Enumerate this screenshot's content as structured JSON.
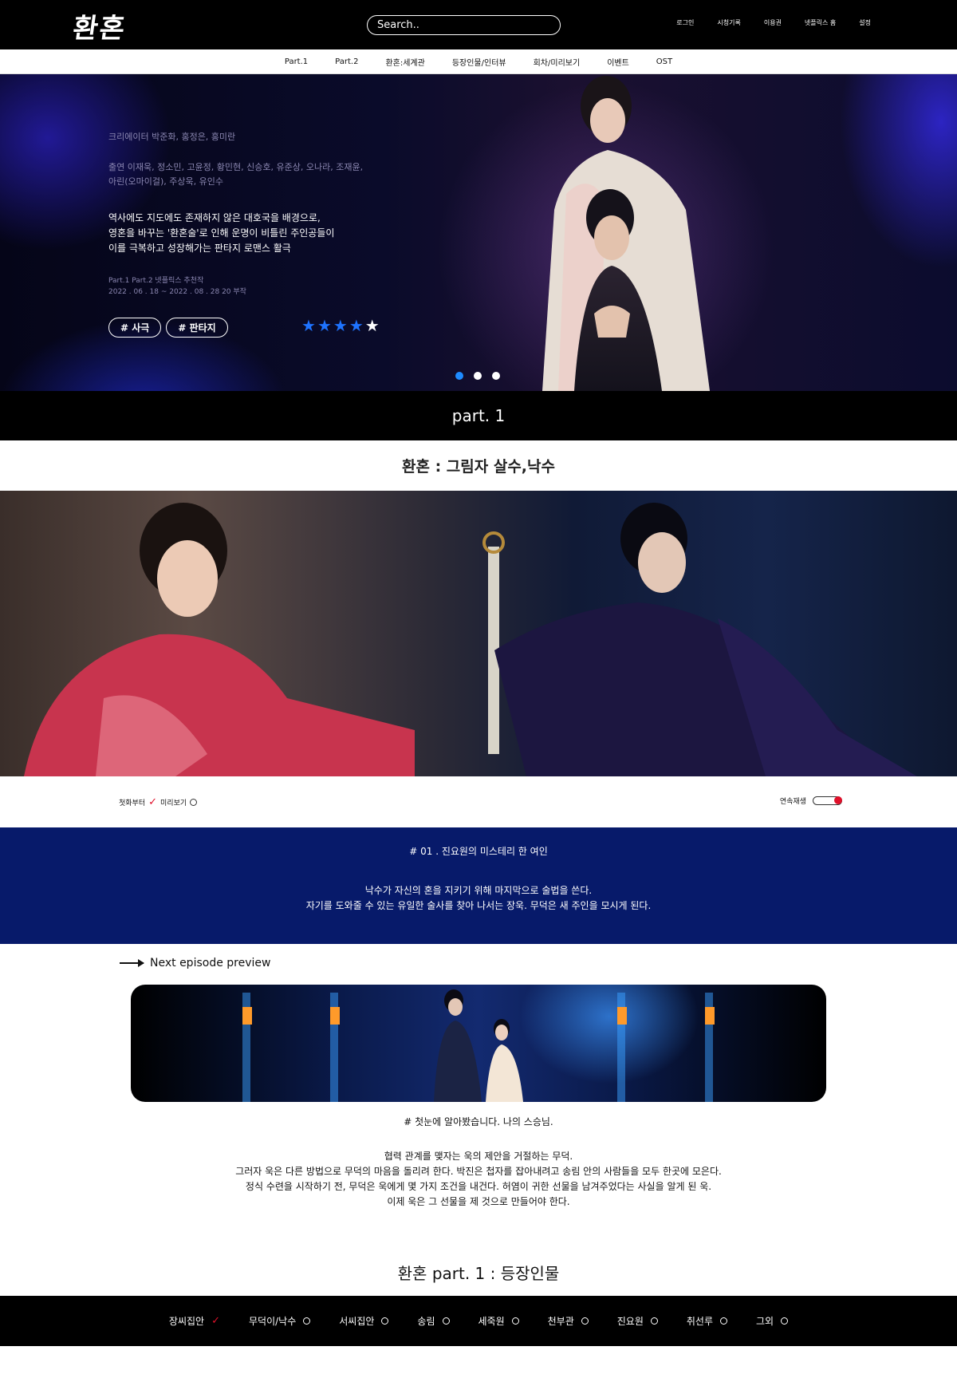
{
  "header": {
    "logo": "환혼",
    "search_placeholder": "Search..",
    "util_menu": [
      "로그인",
      "시청기록",
      "이용권",
      "넷플릭스 홈",
      "설정"
    ]
  },
  "nav": [
    "Part.1",
    "Part.2",
    "환혼:세계관",
    "등장인물/인터뷰",
    "회차/미리보기",
    "이벤트",
    "OST"
  ],
  "hero": {
    "creators": "크리에이터 박준화, 홍정은, 홍미란",
    "cast_line1": "출연 이재욱, 정소민, 고윤정, 황민현, 신승호, 유준상, 오나라, 조재윤,",
    "cast_line2": "아린(오마이걸), 주상욱, 유인수",
    "synopsis_line1": "역사에도 지도에도 존재하지 않은 대호국을 배경으로,",
    "synopsis_line2": "영혼을 바꾸는 '환혼술'로 인해 운명이 비틀린 주인공들이",
    "synopsis_line3": "이를 극복하고 성장해가는 판타지 로맨스 활극",
    "meta_line1": "Part.1 Part.2 넷플릭스 추천작",
    "meta_line2": "2022 . 06 . 18 ~ 2022 . 08 . 28 20 부작",
    "tags": [
      "# 사극",
      "# 판타지"
    ],
    "rating": 4,
    "rating_max": 5,
    "slide_count": 3,
    "active_slide": 0
  },
  "part_band": "part. 1",
  "section_title": "환혼 : 그림자 살수,낙수",
  "controls": {
    "from_first": "첫화부터",
    "preview": "미리보기",
    "autoplay": "연속재생"
  },
  "episode": {
    "title": "# 01 . 진요원의 미스테리 한 여인",
    "desc_line1": "낙수가 자신의 혼을 지키기 위해 마지막으로 술법을 쓴다.",
    "desc_line2": "자기를 도와줄 수 있는 유일한 술사를 찾아 나서는 장욱. 무덕은 새 주인을 모시게 된다."
  },
  "next_preview_label": "Next episode preview",
  "next_episode": {
    "quote": "# 첫눈에 알아봤습니다. 나의 스승님.",
    "story_lines": [
      "협력 관계를 맺자는 욱의 제안을 거절하는 무덕.",
      "그러자 욱은 다른 방법으로 무덕의 마음을 돌리려 한다. 박진은 첩자를 잡아내려고 송림 안의 사람들을 모두 한곳에 모은다.",
      "정식 수련을 시작하기 전, 무덕은 욱에게 몇 가지 조건을 내건다. 허염이 귀한 선물을 남겨주었다는 사실을 알게 된 욱.",
      "이제 욱은 그 선물을 제 것으로 만들어야 한다."
    ]
  },
  "characters_title": "환혼  part. 1 : 등장인물",
  "character_tabs": [
    "장씨집안",
    "무덕이/낙수",
    "서씨집안",
    "송림",
    "세죽원",
    "천부관",
    "진요원",
    "취선루",
    "그외"
  ],
  "colors": {
    "accent_blue": "#1e73ff",
    "accent_red": "#e0102a",
    "episode_bg": "#071a6a"
  }
}
